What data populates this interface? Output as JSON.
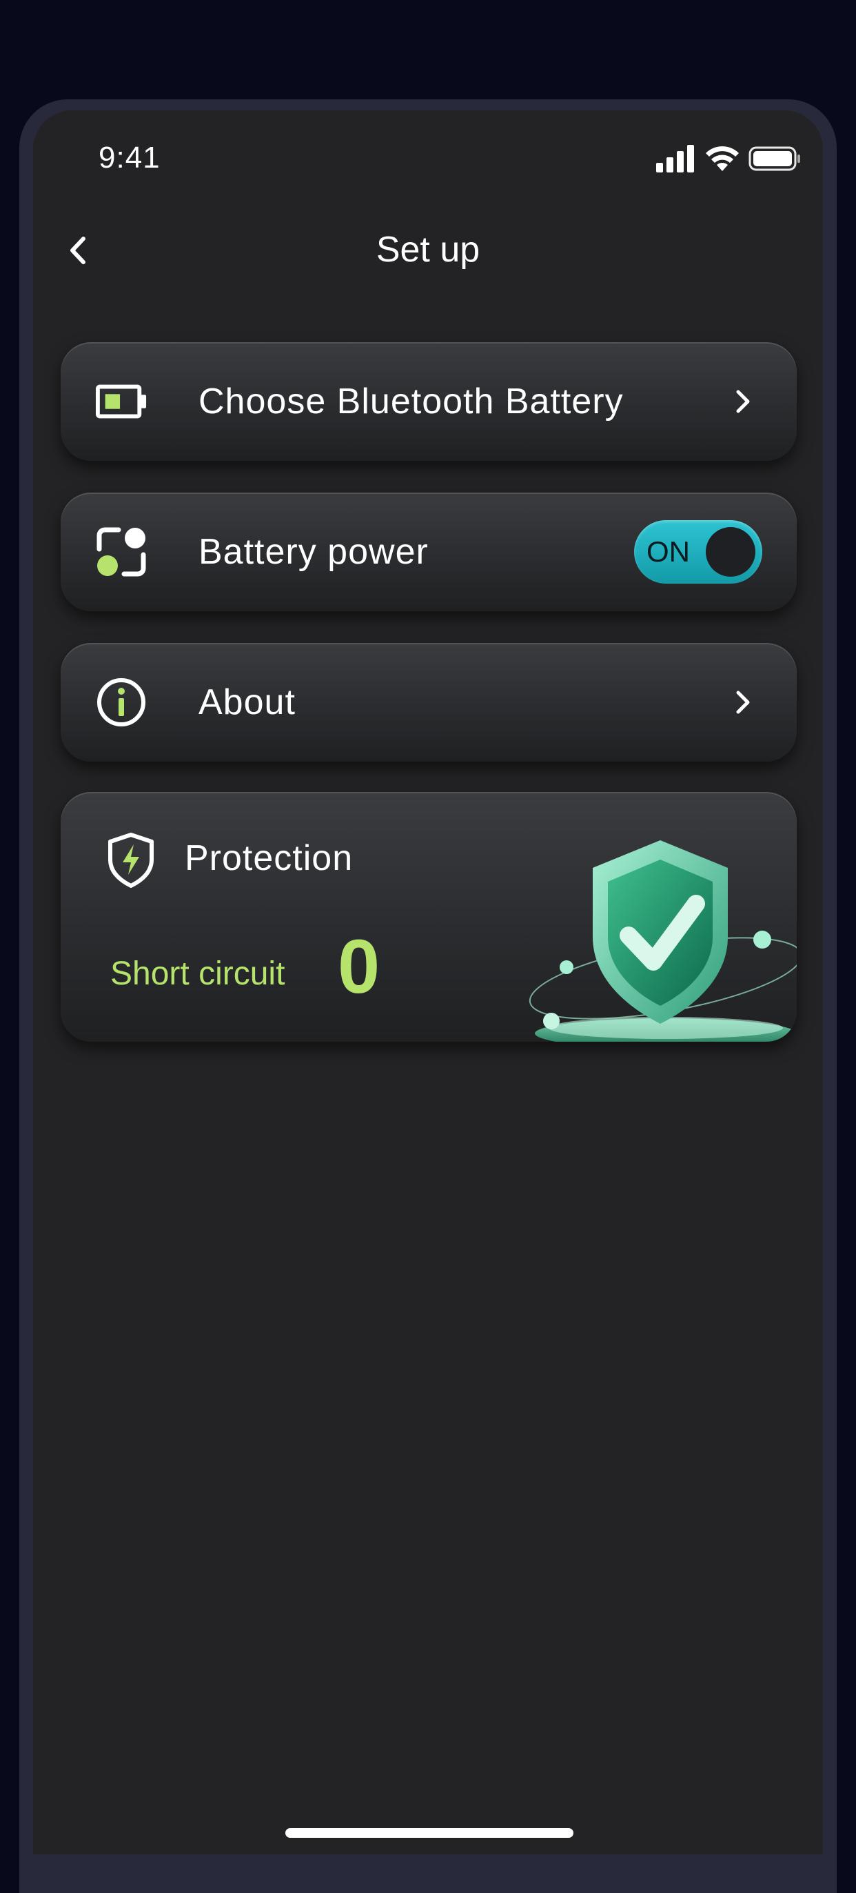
{
  "status_bar": {
    "time": "9:41",
    "signal_icon": "cellular-signal-icon",
    "wifi_icon": "wifi-icon",
    "battery_icon": "battery-full-icon"
  },
  "nav": {
    "back_icon": "chevron-left-icon",
    "title": "Set up"
  },
  "menu": {
    "items": [
      {
        "label": "Choose Bluetooth Battery",
        "icon": "battery-icon",
        "trailing": "chevron-right-icon"
      },
      {
        "label": "Battery power",
        "icon": "power-toggle-icon",
        "trailing": "toggle",
        "toggle_state": "ON"
      },
      {
        "label": "About",
        "icon": "info-icon",
        "trailing": "chevron-right-icon"
      }
    ]
  },
  "protection": {
    "icon": "shield-bolt-icon",
    "title": "Protection",
    "short_circuit_label": "Short circuit",
    "short_circuit_value": "0",
    "illustration": "shield-check-illustration"
  },
  "colors": {
    "background": "#080a1c",
    "screen": "#232325",
    "accent_green": "#b6e36b",
    "toggle_teal": "#1fb0be"
  }
}
